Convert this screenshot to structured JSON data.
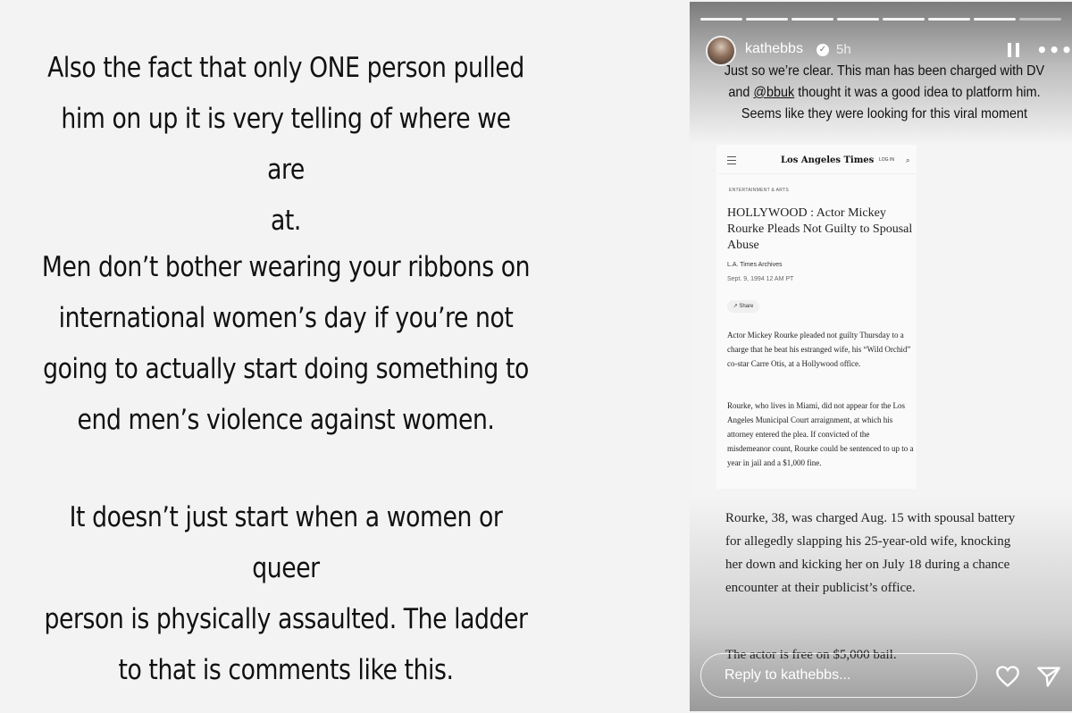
{
  "left_panel": {
    "paragraph1": [
      "Also the fact that only ONE person pulled",
      "him on up it is very telling of where we are",
      "at."
    ],
    "paragraph2": [
      "Men don’t bother wearing your ribbons on",
      "international women’s day if you’re not",
      "going to actually start doing something to",
      "end men’s violence against women."
    ],
    "paragraph3": [
      "It doesn’t just start when a women or queer",
      "person is physically assaulted. The ladder",
      "to that is comments like this."
    ]
  },
  "story": {
    "username": "kathebbs",
    "time": "5h",
    "caption_before_mention": "Just so we’re clear. This man has been charged with DV and ",
    "mention": "@bbuk",
    "caption_after_mention": " thought it was a good idea to platform him. Seems like they were looking for this viral moment",
    "reply_placeholder": "Reply to kathebbs...",
    "icons": {
      "pause": "pause-icon",
      "more": "more-icon",
      "like": "heart-icon",
      "send": "send-icon",
      "verified": "verified-icon"
    }
  },
  "article": {
    "logo": "Los Angeles Times",
    "login": "LOG IN",
    "section": "ENTERTAINMENT & ARTS",
    "headline": "HOLLYWOOD : Actor Mickey Rourke Pleads Not Guilty to Spousal Abuse",
    "byline": "L.A. Times Archives",
    "date": "Sept. 9, 1994 12 AM PT",
    "share": "Share",
    "para1": "Actor Mickey Rourke pleaded not guilty Thursday to a charge that he beat his estranged wife, his “Wild Orchid” co-star Carre Otis, at a Hollywood office.",
    "para2": "Rourke, who lives in Miami, did not appear for the Los Angeles Municipal Court arraignment, at which his attorney entered the plea. If convicted of the misdemeanor count, Rourke could be sentenced to up to a year in jail and a $1,000 fine.",
    "excerpt1": "Rourke, 38, was charged Aug. 15 with spousal battery for allegedly slapping his 25-year-old wife, knocking her down and kicking her on July 18 during a chance encounter at their publicist’s office.",
    "excerpt2": "The actor is free on $5,000 bail."
  }
}
